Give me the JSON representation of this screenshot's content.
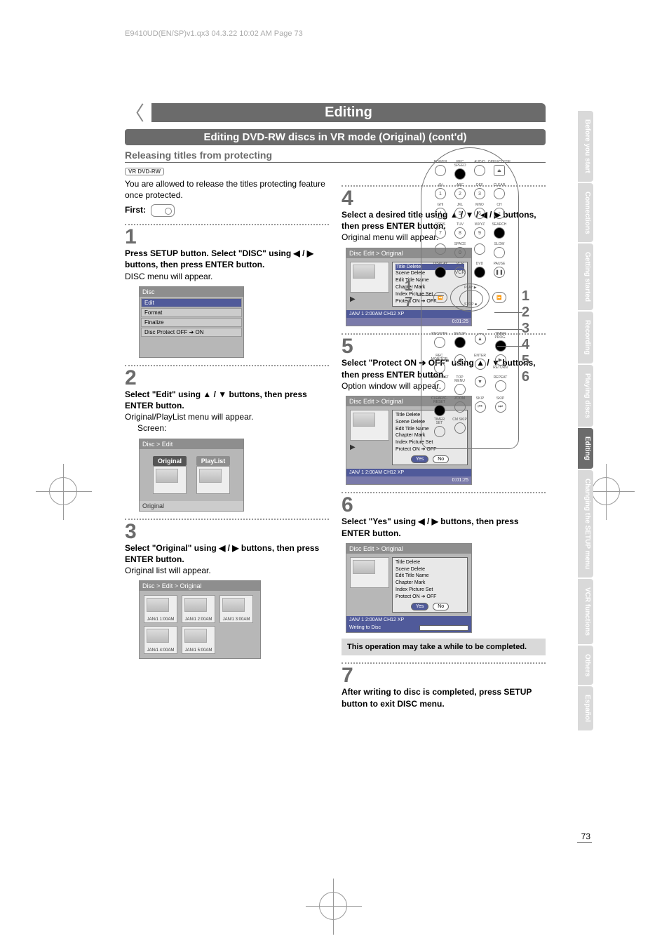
{
  "header_line": "E9410UD(EN/SP)v1.qx3  04.3.22  10:02 AM  Page 73",
  "title": "Editing",
  "subtitle": "Editing DVD-RW discs in VR mode (Original) (cont'd)",
  "section_head": "Releasing titles from protecting",
  "badge": "VR DVD-RW",
  "intro": "You are allowed to release the titles protecting feature once protected.",
  "first_label": "First:",
  "steps": {
    "1": {
      "bold": "Press SETUP button. Select \"DISC\" using ◀ / ▶ buttons, then press ENTER button.",
      "plain": "DISC menu will appear."
    },
    "2": {
      "bold": "Select \"Edit\" using ▲ / ▼ buttons, then press ENTER button.",
      "plain": "Original/PlayList menu will appear.",
      "sub": "Screen:"
    },
    "3": {
      "bold": "Select \"Original\" using ◀ / ▶ buttons, then press ENTER button.",
      "plain": "Original list will appear."
    },
    "4": {
      "bold": "Select a desired title using ▲ / ▼ / ◀ / ▶  buttons, then press ENTER button.",
      "plain": "Original menu will appear."
    },
    "5": {
      "bold": "Select \"Protect ON ➔ OFF\" using ▲ / ▼ buttons, then press ENTER button.",
      "plain": "Option window will appear."
    },
    "6": {
      "bold": "Select \"Yes\" using  ◀ / ▶  buttons, then press ENTER button."
    },
    "7": {
      "bold": "After writing to disc is completed, press SETUP button to exit DISC menu."
    }
  },
  "note": "This operation may take a while to be completed.",
  "osd1": {
    "header": "Disc",
    "rows": [
      "Edit",
      "Format",
      "Finalize",
      "Disc Protect OFF ➔ ON"
    ]
  },
  "osd2": {
    "header": "Disc > Edit",
    "left": "Original",
    "right": "PlayList",
    "caption": "Original"
  },
  "osd3": {
    "header": "Disc > Edit > Original",
    "thumbs": [
      "JAN/1  1:00AM",
      "JAN/1  2:00AM",
      "JAN/1  3:00AM",
      "JAN/1  4:00AM",
      "JAN/1  5:00AM"
    ]
  },
  "osd4": {
    "header": "Disc Edit > Original",
    "list": [
      "Title Delete",
      "Scene Delete",
      "Edit Title Name",
      "Chapter Mark",
      "Index Picture Set",
      "Protect ON ➔ OFF"
    ],
    "highlight": 0,
    "footer_left": "JAN/ 1   2:00AM  CH12     XP",
    "footer_right": "0:01:25"
  },
  "osd5": {
    "header": "Disc Edit > Original",
    "list": [
      "Title Delete",
      "Scene Delete",
      "Edit Title Name",
      "Chapter Mark",
      "Index Picture Set",
      "Protect ON ➔ OFF"
    ],
    "yes": "Yes",
    "no": "No",
    "yn_sel": "yes",
    "footer_left": "JAN/ 1   2:00AM  CH12     XP",
    "footer_right": "0:01:25"
  },
  "osd6": {
    "header": "Disc Edit > Original",
    "list": [
      "Title Delete",
      "Scene Delete",
      "Edit Title Name",
      "Chapter Mark",
      "Index Picture Set",
      "Protect ON ➔ OFF"
    ],
    "yes": "Yes",
    "no": "No",
    "yn_sel": "yes",
    "footer_left": "JAN/ 1   2:00AM  CH12     XP",
    "writing": "Writing to Disc"
  },
  "remote": {
    "row1": [
      "POWER",
      "REC SPEED",
      "AUDIO",
      "OPEN/CLOSE"
    ],
    "row2": [
      ".@/:",
      "ABC",
      "DEF",
      "CLEAR"
    ],
    "row3": [
      "GHI",
      "JKL",
      "MNO",
      ""
    ],
    "row4": [
      "PQRS",
      "TUV",
      "WXYZ",
      "SEARCH"
    ],
    "row5": [
      "",
      "SPACE",
      "",
      "SLOW"
    ],
    "row6": [
      "DISPLAY",
      "VCR",
      "DVD",
      "PAUSE"
    ],
    "play": "PLAY",
    "frev": "⏮",
    "stop_btn": "STOP",
    "ffwd": "⏭",
    "mid": [
      "REC/OTR",
      "SETUP",
      "",
      "TIMER PROG."
    ],
    "mid_labels": [
      "",
      "",
      "ENTER",
      ""
    ],
    "mid2": [
      "REC MONITOR",
      "",
      "",
      "RETURN"
    ],
    "mid3": [
      "MENU/LIST",
      "TOP MENU",
      "",
      "REPEAT"
    ],
    "mid4": [
      "CLEAR/C-RESET",
      "ZOOM",
      "SKIP",
      "SKIP"
    ],
    "mid5_labels": [
      "TIMER SET",
      "CM SKIP"
    ],
    "mid5": [
      "",
      "",
      "",
      ""
    ]
  },
  "callout_left": [
    "1",
    "7"
  ],
  "callout_right": [
    "1",
    "2",
    "3",
    "4",
    "5",
    "6"
  ],
  "tabs": [
    "Before you start",
    "Connections",
    "Getting started",
    "Recording",
    "Playing discs",
    "Editing",
    "Changing the SETUP menu",
    "VCR functions",
    "Others",
    "Español"
  ],
  "tabs_active": 5,
  "page_num": "73"
}
